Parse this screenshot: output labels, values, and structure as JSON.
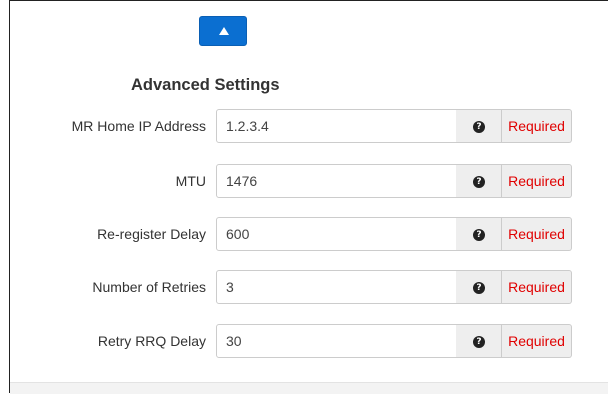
{
  "collapse_button": {
    "icon": "triangle-up-icon",
    "color": "#0b6fd1"
  },
  "section": {
    "title": "Advanced Settings"
  },
  "help_icon_glyph": "?",
  "required_color": "#e00000",
  "fields": [
    {
      "label": "MR Home IP Address",
      "value": "1.2.3.4",
      "addon": "Required"
    },
    {
      "label": "MTU",
      "value": "1476",
      "addon": "Required"
    },
    {
      "label": "Re-register Delay",
      "value": "600",
      "addon": "Required"
    },
    {
      "label": "Number of Retries",
      "value": "3",
      "addon": "Required"
    },
    {
      "label": "Retry RRQ Delay",
      "value": "30",
      "addon": "Required"
    }
  ]
}
